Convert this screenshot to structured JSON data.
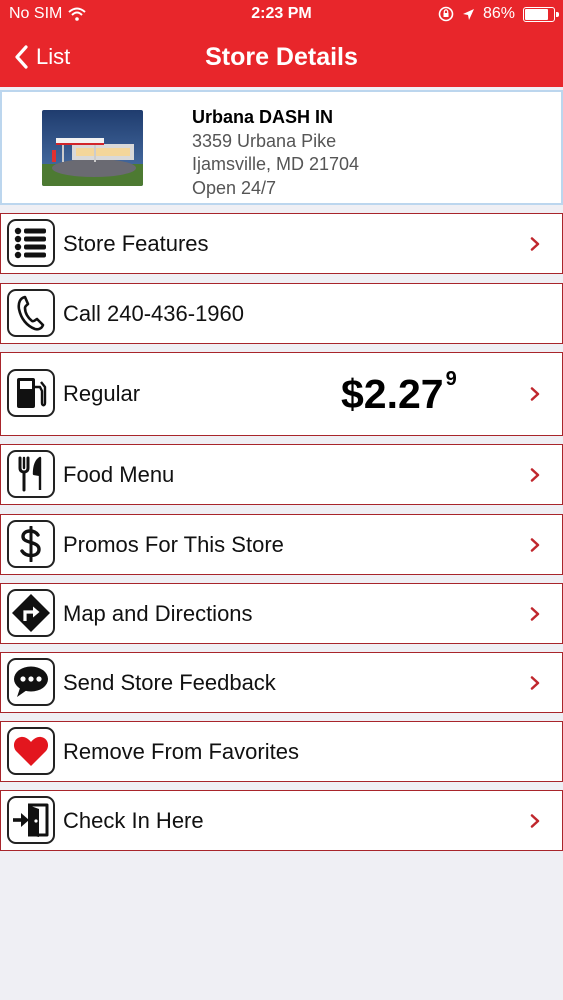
{
  "status_bar": {
    "carrier": "No SIM",
    "time": "2:23 PM",
    "battery": "86%",
    "battery_level": 0.86
  },
  "nav": {
    "back_label": "List",
    "title": "Store Details"
  },
  "store": {
    "name": "Urbana DASH IN",
    "address1": "3359 Urbana Pike",
    "address2": "Ijamsville, MD 21704",
    "hours": "Open 24/7"
  },
  "menu": {
    "features": {
      "label": "Store Features",
      "icon": "list-icon"
    },
    "call": {
      "label": "Call 240-436-1960",
      "icon": "phone-icon"
    },
    "fuel": {
      "label": "Regular",
      "price": "$2.27",
      "price_tenth": "9",
      "icon": "fuel-pump-icon"
    },
    "food": {
      "label": "Food Menu",
      "icon": "fork-knife-icon"
    },
    "promos": {
      "label": "Promos For This Store",
      "icon": "dollar-icon"
    },
    "map": {
      "label": "Map and Directions",
      "icon": "directions-icon"
    },
    "feedback": {
      "label": "Send Store Feedback",
      "icon": "chat-bubble-icon"
    },
    "favorites": {
      "label": "Remove From Favorites",
      "icon": "heart-icon"
    },
    "checkin": {
      "label": "Check In Here",
      "icon": "check-in-icon"
    }
  },
  "colors": {
    "brand_red": "#e8262b",
    "row_border": "#a8252b",
    "chevron": "#c0272d",
    "store_border": "#bcd6ee"
  }
}
